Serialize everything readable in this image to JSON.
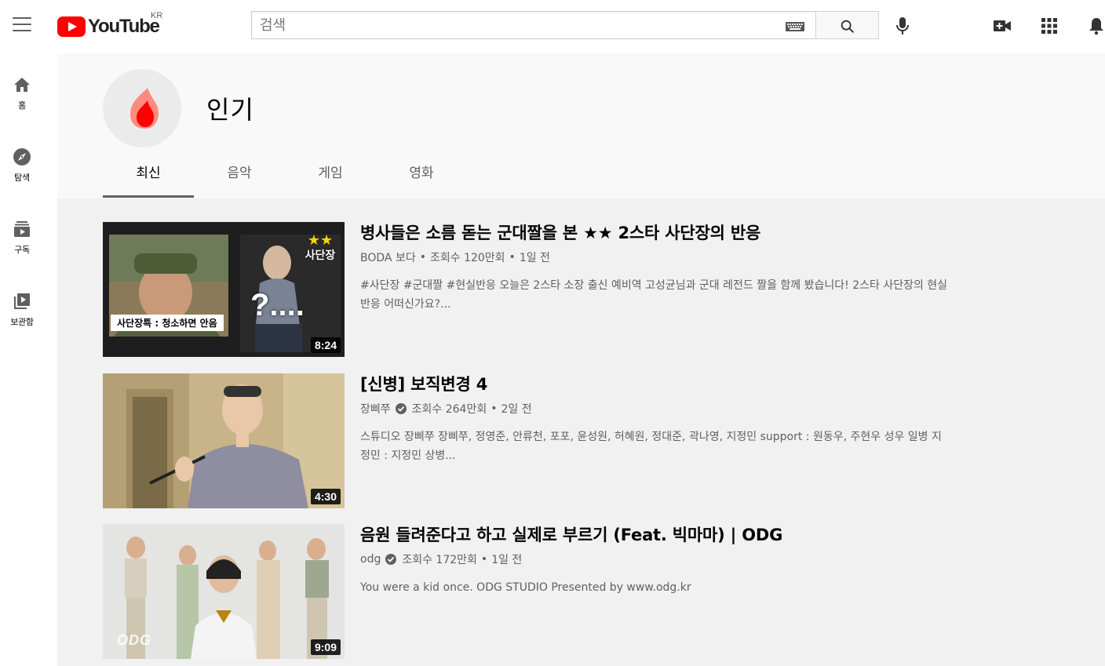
{
  "topbar": {
    "logo_text": "YouTube",
    "country_code": "KR",
    "search_placeholder": "검색"
  },
  "nav": [
    {
      "label": "홈",
      "icon": "home-icon"
    },
    {
      "label": "탐색",
      "icon": "explore-icon"
    },
    {
      "label": "구독",
      "icon": "subscriptions-icon"
    },
    {
      "label": "보관함",
      "icon": "library-icon"
    }
  ],
  "header": {
    "title": "인기",
    "tabs": [
      "최신",
      "음악",
      "게임",
      "영화"
    ],
    "active_tab": "최신"
  },
  "videos": [
    {
      "title": "병사들은 소름 돋는 군대짤을 본 ★★ 2스타 사단장의 반응",
      "channel": "BODA 보다",
      "verified": false,
      "views": "조회수 120만회",
      "age": "1일 전",
      "description": "#사단장 #군대짤 #현실반응 오늘은 2스타 소장 출신 예비역 고성균님과 군대 레전드 짤을 함께 봤습니다! 2스타 사단장의 현실반응 어떠신가요?...",
      "duration": "8:24",
      "thumb_caption": "사단장특 : 청소하면 안음",
      "thumb_badge_stars": "★★",
      "thumb_badge_text": "사단장",
      "thumb_overlay": "?...."
    },
    {
      "title": "[신병] 보직변경 4",
      "channel": "장삐쭈",
      "verified": true,
      "views": "조회수 264만회",
      "age": "2일 전",
      "description": "스튜디오 장삐쭈 장삐쭈, 정영준, 안류천, 포포, 윤성원, 허혜원, 정대준, 곽나영, 지정민 support : 원동우, 주현우 성우 일병 지정민 : 지정민 상병...",
      "duration": "4:30"
    },
    {
      "title": "음원 들려준다고 하고 실제로 부르기 (Feat. 빅마마) | ODG",
      "channel": "odg",
      "verified": true,
      "views": "조회수 172만회",
      "age": "1일 전",
      "description": "You were a kid once. ODG STUDIO Presented by www.odg.kr",
      "duration": "9:09",
      "thumb_watermark": "ODG"
    }
  ],
  "colors": {
    "brand_red": "#ff0000",
    "header_bg": "#f9f9f9",
    "content_bg": "#f1f1f1",
    "text_primary": "#030303",
    "text_secondary": "#606060"
  }
}
